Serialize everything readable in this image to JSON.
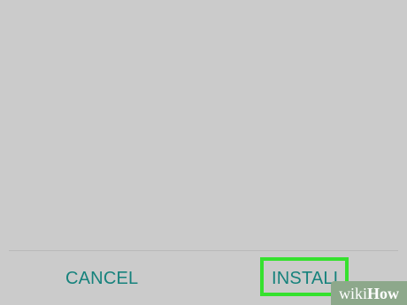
{
  "dialog": {
    "cancel_label": "CANCEL",
    "install_label": "INSTALL"
  },
  "watermark": {
    "prefix": "wiki",
    "suffix": "How"
  },
  "colors": {
    "background": "#cbcbcb",
    "button_text": "#16827c",
    "highlight": "#35e12e",
    "watermark_bg": "#8da88b"
  }
}
